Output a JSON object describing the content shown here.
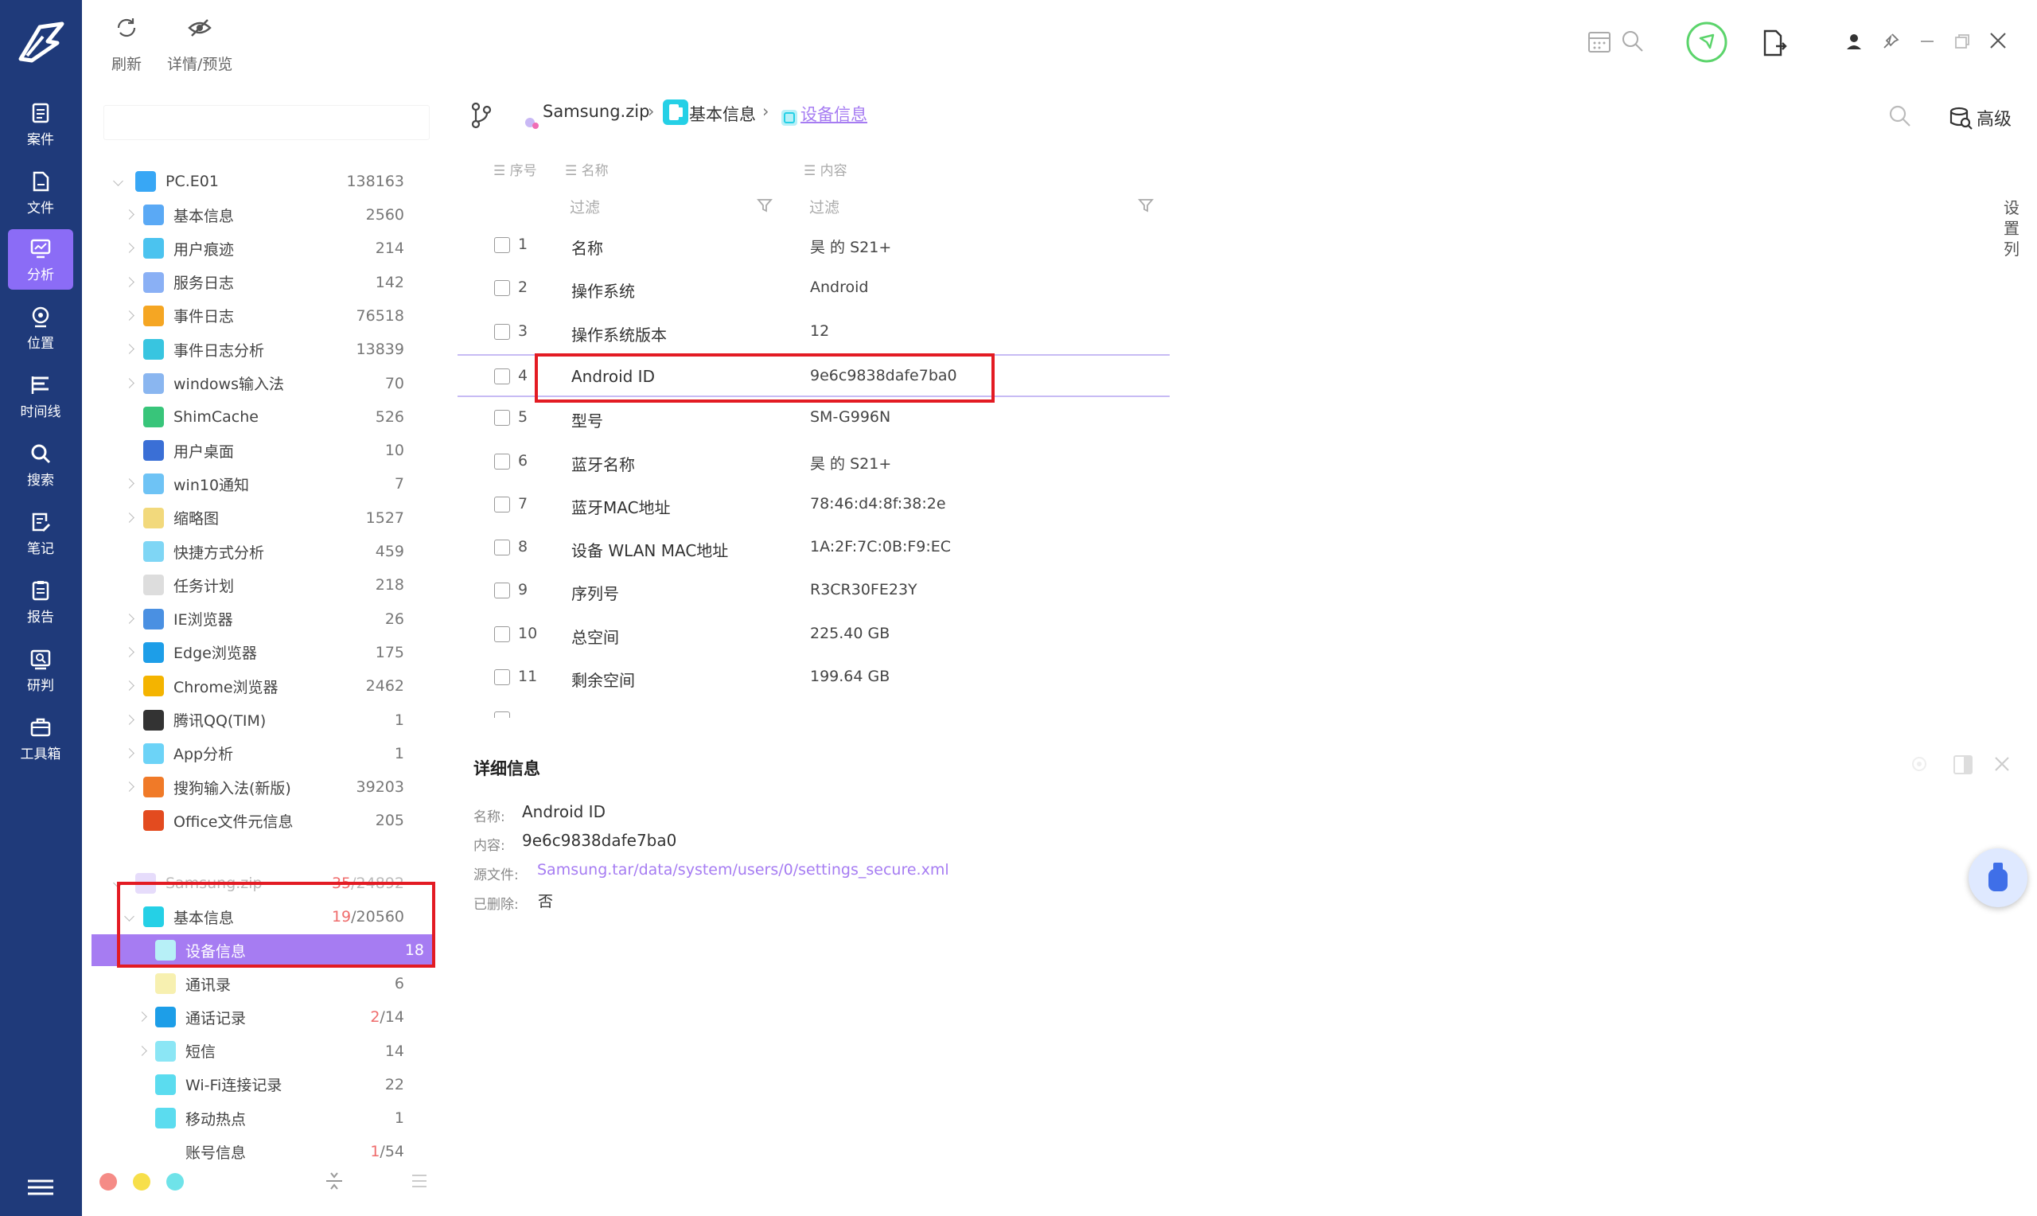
{
  "nav": {
    "items": [
      {
        "label": "案件",
        "icon": "case-icon"
      },
      {
        "label": "文件",
        "icon": "file-icon"
      },
      {
        "label": "分析",
        "icon": "analysis-icon",
        "active": true
      },
      {
        "label": "位置",
        "icon": "location-icon"
      },
      {
        "label": "时间线",
        "icon": "timeline-icon"
      },
      {
        "label": "搜索",
        "icon": "search-icon"
      },
      {
        "label": "笔记",
        "icon": "note-icon"
      },
      {
        "label": "报告",
        "icon": "report-icon"
      },
      {
        "label": "研判",
        "icon": "judge-icon"
      },
      {
        "label": "工具箱",
        "icon": "toolbox-icon"
      }
    ]
  },
  "toolbar": {
    "refresh": "刷新",
    "detail_preview": "详情/预览"
  },
  "tree": {
    "root": {
      "label": "PC.E01",
      "count": "138163"
    },
    "items": [
      {
        "label": "基本信息",
        "count": "2560"
      },
      {
        "label": "用户痕迹",
        "count": "214"
      },
      {
        "label": "服务日志",
        "count": "142"
      },
      {
        "label": "事件日志",
        "count": "76518"
      },
      {
        "label": "事件日志分析",
        "count": "13839"
      },
      {
        "label": "windows输入法",
        "count": "70"
      },
      {
        "label": "ShimCache",
        "count": "526"
      },
      {
        "label": "用户桌面",
        "count": "10"
      },
      {
        "label": "win10通知",
        "count": "7"
      },
      {
        "label": "缩略图",
        "count": "1527"
      },
      {
        "label": "快捷方式分析",
        "count": "459"
      },
      {
        "label": "任务计划",
        "count": "218"
      },
      {
        "label": "IE浏览器",
        "count": "26"
      },
      {
        "label": "Edge浏览器",
        "count": "175"
      },
      {
        "label": "Chrome浏览器",
        "count": "2462"
      },
      {
        "label": "腾讯QQ(TIM)",
        "count": "1"
      },
      {
        "label": "App分析",
        "count": "1"
      },
      {
        "label": "搜狗输入法(新版)",
        "count": "39203"
      },
      {
        "label": "Office文件元信息",
        "count": "205"
      }
    ],
    "zip": {
      "label": "Samsung.zip",
      "count_red": "35",
      "count_total": "/24892"
    },
    "basic": {
      "label": "基本信息",
      "count_red": "19",
      "count_total": "/20560"
    },
    "sub": [
      {
        "label": "设备信息",
        "count": "18"
      },
      {
        "label": "通讯录",
        "count": "6"
      },
      {
        "label": "通话记录",
        "count_red": "2",
        "count_total": "/14"
      },
      {
        "label": "短信",
        "count": "14"
      },
      {
        "label": "Wi-Fi连接记录",
        "count": "22"
      },
      {
        "label": "移动热点",
        "count": "1"
      },
      {
        "label": "账号信息",
        "count_red": "1",
        "count_total": "/54"
      }
    ]
  },
  "breadcrumb": {
    "zip": "Samsung.zip",
    "sep": "›",
    "basic": "基本信息",
    "current": "设备信息"
  },
  "header_right": {
    "advanced": "高级",
    "column_settings": "设置列"
  },
  "table": {
    "headers": {
      "index": "序号",
      "name": "名称",
      "content": "内容"
    },
    "filter_placeholder": "过滤",
    "rows": [
      {
        "n": "1",
        "name": "名称",
        "value": "昊 的 S21+"
      },
      {
        "n": "2",
        "name": "操作系统",
        "value": "Android"
      },
      {
        "n": "3",
        "name": "操作系统版本",
        "value": "12"
      },
      {
        "n": "4",
        "name": "Android ID",
        "value": "9e6c9838dafe7ba0"
      },
      {
        "n": "5",
        "name": "型号",
        "value": "SM-G996N"
      },
      {
        "n": "6",
        "name": "蓝牙名称",
        "value": "昊 的 S21+"
      },
      {
        "n": "7",
        "name": "蓝牙MAC地址",
        "value": "78:46:d4:8f:38:2e"
      },
      {
        "n": "8",
        "name": "设备 WLAN MAC地址",
        "value": "1A:2F:7C:0B:F9:EC"
      },
      {
        "n": "9",
        "name": "序列号",
        "value": "R3CR30FE23Y"
      },
      {
        "n": "10",
        "name": "总空间",
        "value": "225.40 GB"
      },
      {
        "n": "11",
        "name": "剩余空间",
        "value": "199.64 GB"
      }
    ]
  },
  "details": {
    "title": "详细信息",
    "name_label": "名称:",
    "name_value": "Android ID",
    "content_label": "内容:",
    "content_value": "9e6c9838dafe7ba0",
    "source_label": "源文件:",
    "source_value": "Samsung.tar/data/system/users/0/settings_secure.xml",
    "deleted_label": "已删除:",
    "deleted_value": "否"
  },
  "colors": {
    "nav_bg": "#1f3a7a",
    "accent": "#a67cf2",
    "highlight_box": "#e31b23"
  }
}
